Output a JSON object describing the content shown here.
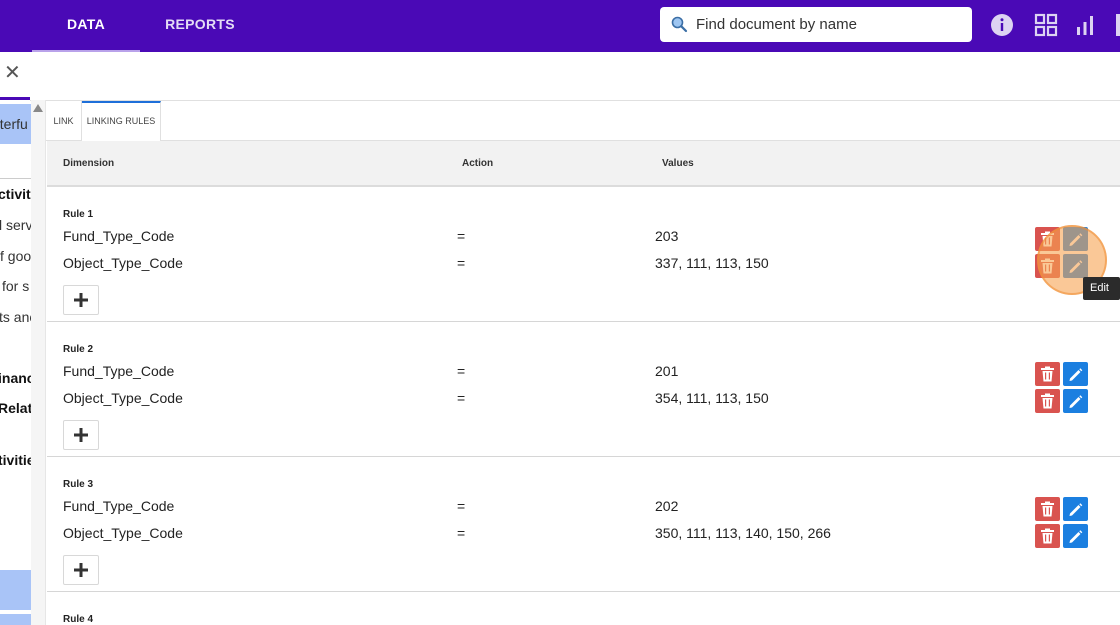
{
  "topbar": {
    "tabs": [
      {
        "label": "DATA",
        "active": true
      },
      {
        "label": "REPORTS",
        "active": false
      }
    ],
    "search": {
      "placeholder": "Find document by name",
      "value": ""
    },
    "icons": [
      "info-icon",
      "grid-apps-icon",
      "bar-chart-icon"
    ]
  },
  "sidebar": {
    "items": [
      "nterfu",
      "ctiviti",
      "l serv",
      "f goo",
      "for s",
      "ts anc",
      "inanc",
      "Relate",
      "tivitie"
    ]
  },
  "sub_tabs": [
    {
      "label": "LINK",
      "active": false
    },
    {
      "label": "LINKING RULES",
      "active": true
    }
  ],
  "table": {
    "headers": {
      "dimension": "Dimension",
      "action": "Action",
      "values": "Values"
    },
    "rules": [
      {
        "label": "Rule 1",
        "rows": [
          {
            "dimension": "Fund_Type_Code",
            "action": "=",
            "values": "203"
          },
          {
            "dimension": "Object_Type_Code",
            "action": "=",
            "values": "337, 111, 113, 150"
          }
        ]
      },
      {
        "label": "Rule 2",
        "rows": [
          {
            "dimension": "Fund_Type_Code",
            "action": "=",
            "values": "201"
          },
          {
            "dimension": "Object_Type_Code",
            "action": "=",
            "values": "354, 111, 113, 150"
          }
        ]
      },
      {
        "label": "Rule 3",
        "rows": [
          {
            "dimension": "Fund_Type_Code",
            "action": "=",
            "values": "202"
          },
          {
            "dimension": "Object_Type_Code",
            "action": "=",
            "values": "350, 111, 113, 140, 150, 266"
          }
        ]
      },
      {
        "label": "Rule 4",
        "rows": []
      }
    ]
  },
  "tooltip": {
    "text": "Edit"
  },
  "colors": {
    "topbar": "#4a09b6",
    "delete": "#d9534f",
    "edit": "#1b7fe0",
    "highlight": "#a9c4f7"
  }
}
